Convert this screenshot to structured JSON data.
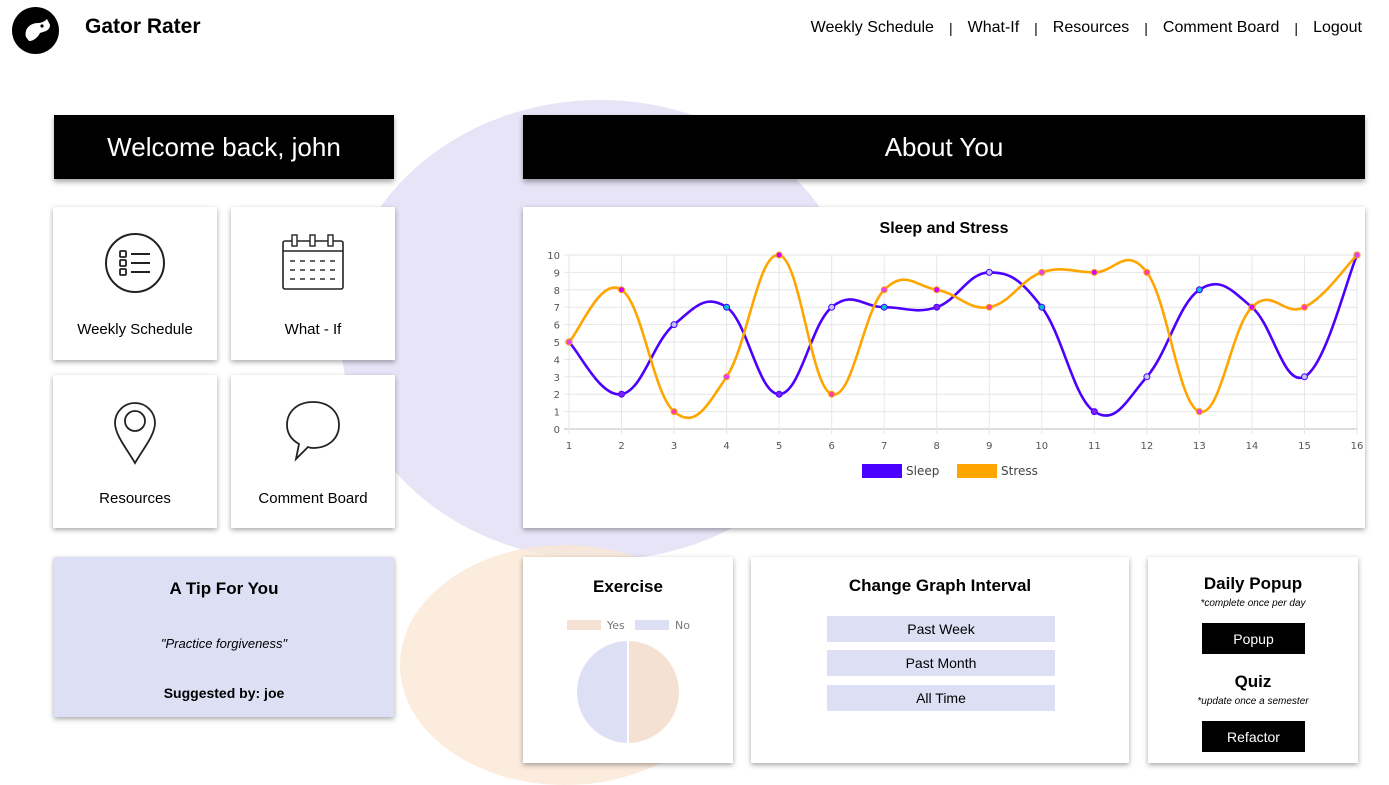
{
  "app": {
    "title": "Gator Rater",
    "logo_icon": "gator-head-icon"
  },
  "nav": {
    "items": [
      "Weekly Schedule",
      "What-If",
      "Resources",
      "Comment Board",
      "Logout"
    ],
    "separator": "|"
  },
  "welcome": {
    "text": "Welcome back, john"
  },
  "about": {
    "text": "About You"
  },
  "tiles": [
    {
      "label": "Weekly Schedule",
      "icon": "list-icon"
    },
    {
      "label": "What - If",
      "icon": "calendar-icon"
    },
    {
      "label": "Resources",
      "icon": "map-pin-icon"
    },
    {
      "label": "Comment Board",
      "icon": "speech-bubble-icon"
    }
  ],
  "tip": {
    "title": "A Tip For You",
    "quote": "\"Practice forgiveness\"",
    "suggested_by": "Suggested by: joe"
  },
  "colors": {
    "sleep": "#4c00ff",
    "stress": "#ffa500",
    "yes": "#f5e1d3",
    "no": "#dde0f5",
    "tip_bg": "#dde0f5"
  },
  "chart_data": [
    {
      "type": "line",
      "title": "Sleep and Stress",
      "x": [
        1,
        2,
        3,
        4,
        5,
        6,
        7,
        8,
        9,
        10,
        11,
        12,
        13,
        14,
        15,
        16
      ],
      "series": [
        {
          "name": "Sleep",
          "values": [
            5,
            2,
            6,
            7,
            2,
            7,
            7,
            7,
            9,
            7,
            1,
            3,
            8,
            7,
            3,
            10
          ]
        },
        {
          "name": "Stress",
          "values": [
            5,
            8,
            1,
            3,
            10,
            2,
            8,
            8,
            7,
            9,
            9,
            9,
            1,
            7,
            7,
            10
          ]
        }
      ],
      "ylim": [
        0,
        10
      ],
      "yticks": [
        0,
        1,
        2,
        3,
        4,
        5,
        6,
        7,
        8,
        9,
        10
      ],
      "grid": true,
      "legend": "bottom"
    },
    {
      "type": "pie",
      "title": "Exercise",
      "categories": [
        "Yes",
        "No"
      ],
      "values": [
        50,
        50
      ],
      "legend": "top"
    }
  ],
  "interval": {
    "title": "Change Graph Interval",
    "options": [
      "Past Week",
      "Past Month",
      "All Time"
    ]
  },
  "popup": {
    "title": "Daily Popup",
    "note": "*complete once per day",
    "button": "Popup"
  },
  "quiz": {
    "title": "Quiz",
    "note": "*update once a semester",
    "button": "Refactor"
  }
}
